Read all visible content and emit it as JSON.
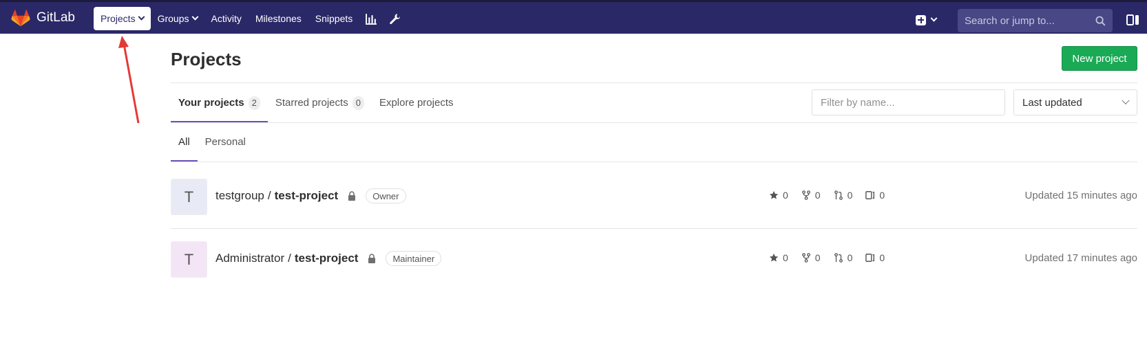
{
  "brand": {
    "name": "GitLab"
  },
  "nav": {
    "projects": "Projects",
    "groups": "Groups",
    "activity": "Activity",
    "milestones": "Milestones",
    "snippets": "Snippets"
  },
  "search": {
    "placeholder": "Search or jump to..."
  },
  "page": {
    "title": "Projects",
    "new_project": "New project"
  },
  "tabs": [
    {
      "label": "Your projects",
      "count": "2"
    },
    {
      "label": "Starred projects",
      "count": "0"
    },
    {
      "label": "Explore projects"
    }
  ],
  "filter": {
    "placeholder": "Filter by name..."
  },
  "sort": {
    "selected": "Last updated"
  },
  "subtabs": [
    {
      "label": "All"
    },
    {
      "label": "Personal"
    }
  ],
  "projects": [
    {
      "avatar_letter": "T",
      "avatar_bg": "#e8eaf6",
      "namespace": "testgroup",
      "separator": "/",
      "name": "test-project",
      "role": "Owner",
      "stars": "0",
      "forks": "0",
      "merge_requests": "0",
      "issues": "0",
      "updated": "Updated 15 minutes ago"
    },
    {
      "avatar_letter": "T",
      "avatar_bg": "#f3e5f5",
      "namespace": "Administrator",
      "separator": "/",
      "name": "test-project",
      "role": "Maintainer",
      "stars": "0",
      "forks": "0",
      "merge_requests": "0",
      "issues": "0",
      "updated": "Updated 17 minutes ago"
    }
  ],
  "colors": {
    "navbar": "#2b2868",
    "accent": "#6b4fbb",
    "success": "#1aaa55",
    "annotation": "#e53935"
  },
  "icons": [
    "gitlab-logo-icon",
    "chevron-down-icon",
    "chart-icon",
    "wrench-icon",
    "plus-square-icon",
    "search-icon",
    "sidebar-toggle-icon",
    "lock-icon",
    "star-icon",
    "fork-icon",
    "merge-request-icon",
    "issues-icon"
  ]
}
